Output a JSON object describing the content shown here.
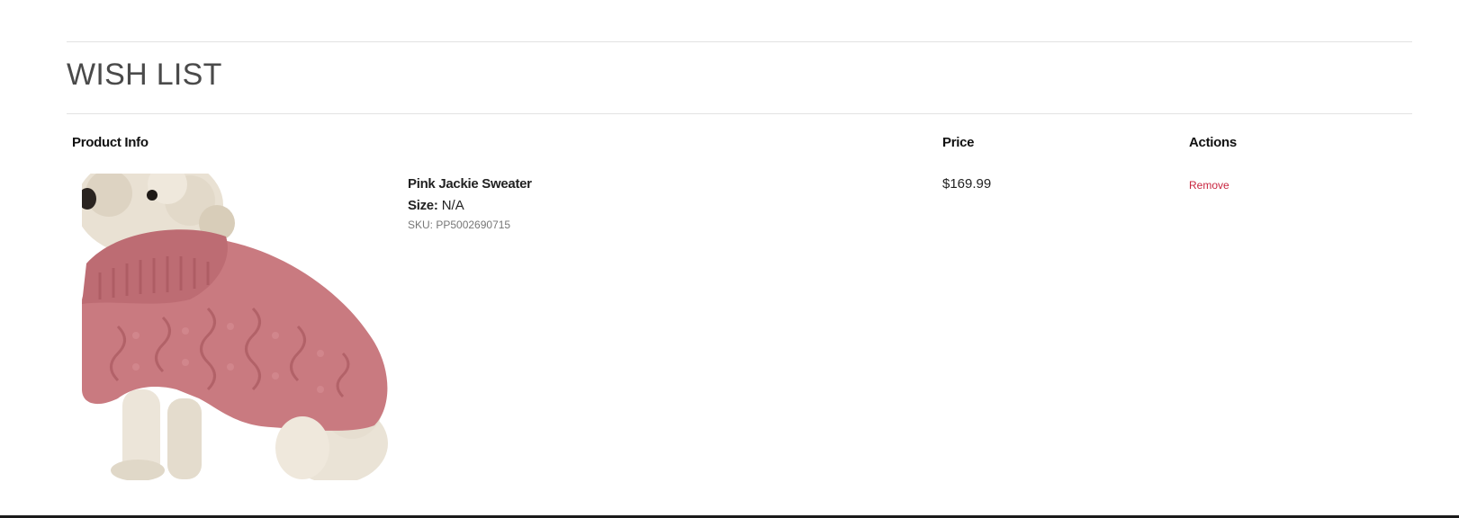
{
  "page": {
    "title": "WISH LIST"
  },
  "table": {
    "headers": {
      "product_info": "Product Info",
      "price": "Price",
      "actions": "Actions"
    },
    "items": [
      {
        "name": "Pink Jackie Sweater",
        "size_label": "Size:",
        "size_value": "N/A",
        "sku": "SKU: PP5002690715",
        "price": "$169.99",
        "remove_label": "Remove",
        "image_icon": "dog-in-pink-sweater-photo"
      }
    ]
  },
  "colors": {
    "accent_remove": "#c8253f",
    "title_text": "#4a4a4a",
    "divider": "#e2e2e2",
    "sweater_pink": "#c97a80"
  }
}
